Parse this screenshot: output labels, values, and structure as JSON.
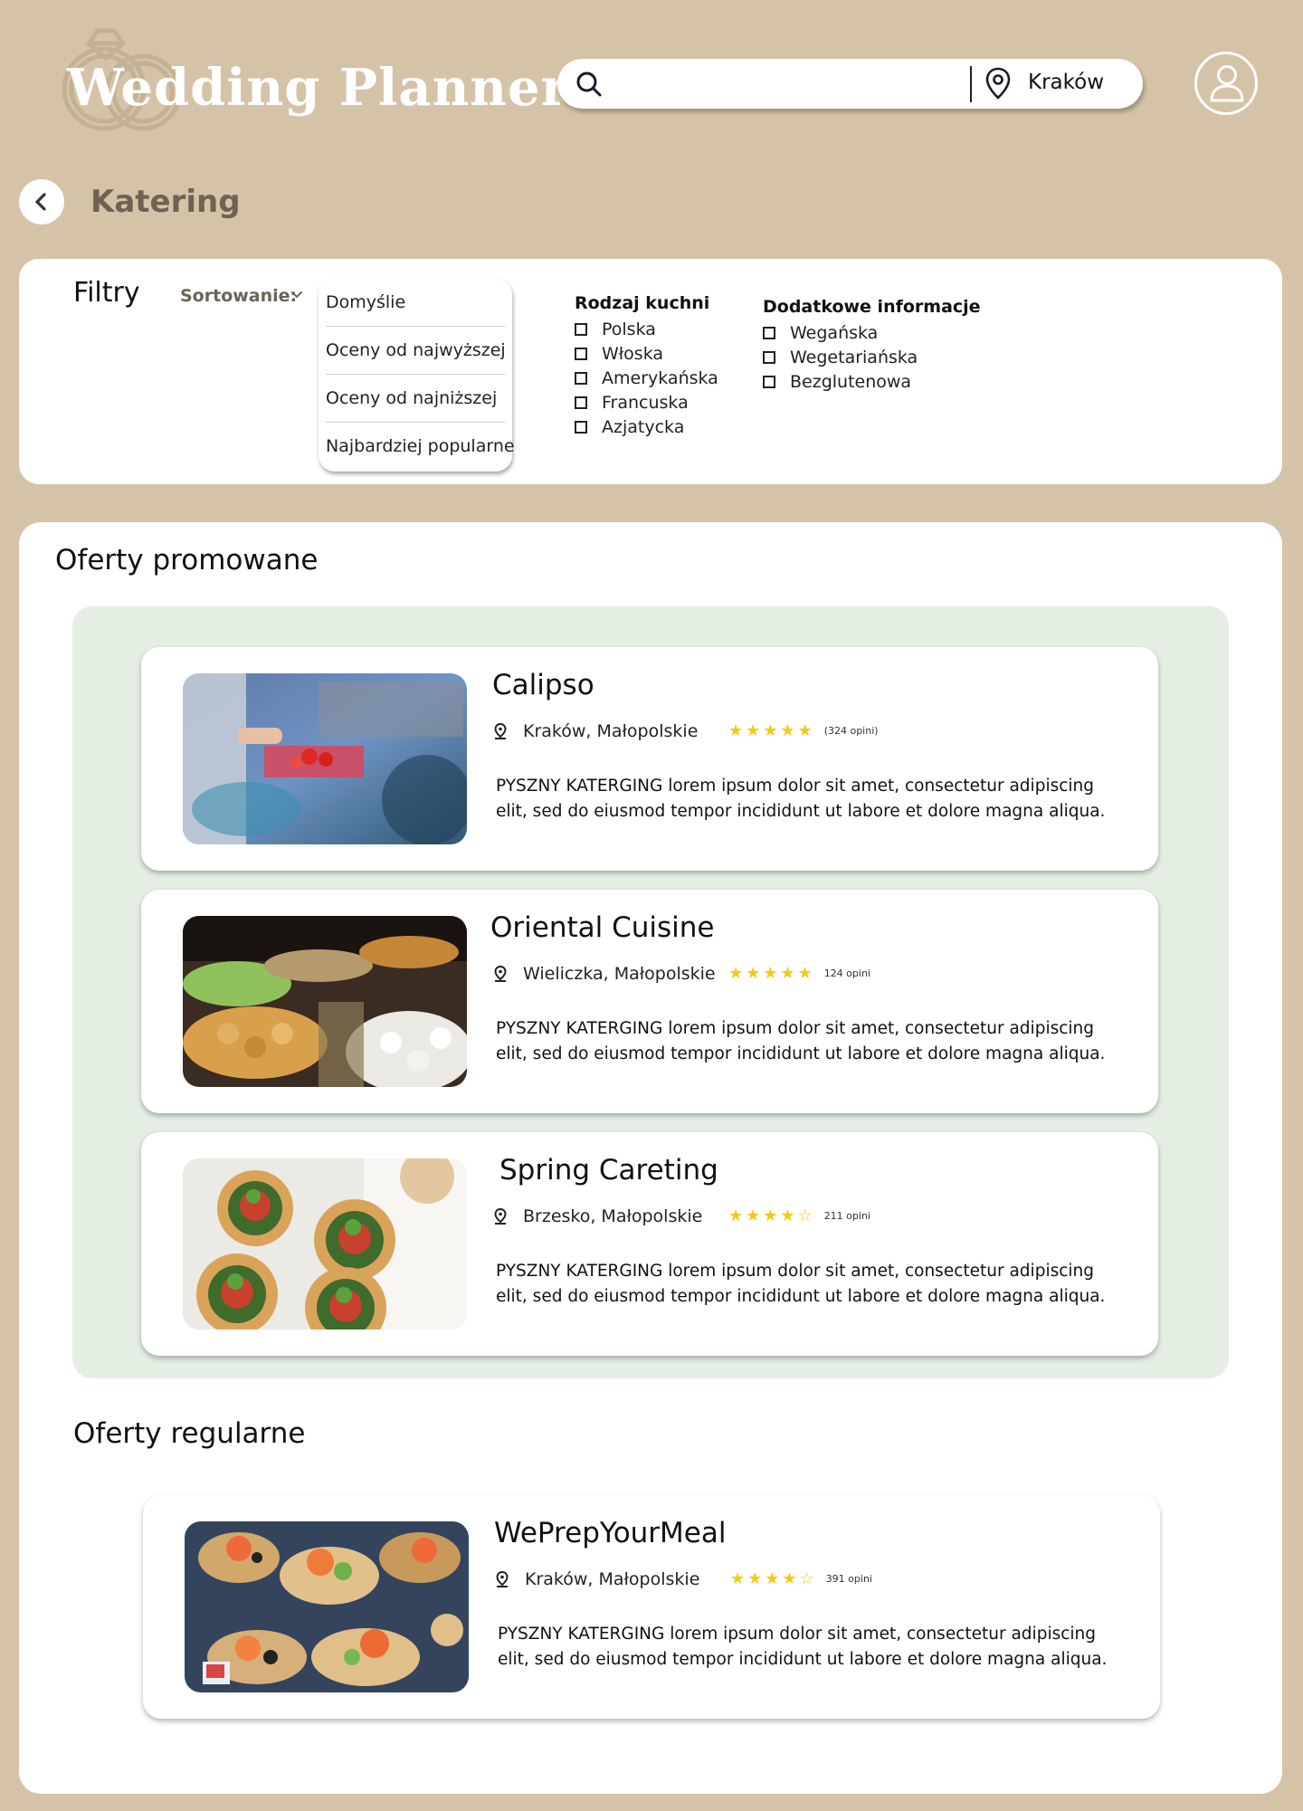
{
  "header": {
    "logo_text": "Wedding Planner",
    "search_placeholder": "",
    "location": "Kraków"
  },
  "page": {
    "title": "Katering"
  },
  "filters": {
    "title": "Filtry",
    "sort_label": "Sortowanie:",
    "sort_options": [
      "Domyślie",
      "Oceny od najwyższej",
      "Oceny od najniższej",
      "Najbardziej popularne"
    ],
    "cuisine": {
      "title": "Rodzaj kuchni",
      "options": [
        "Polska",
        "Włoska",
        "Amerykańska",
        "Francuska",
        "Azjatycka"
      ]
    },
    "extra": {
      "title": "Dodatkowe informacje",
      "options": [
        "Wegańska",
        "Wegetariańska",
        "Bezglutenowa"
      ]
    }
  },
  "promoted": {
    "title": "Oferty promowane",
    "offers": [
      {
        "name": "Calipso",
        "location": "Kraków, Małopolskie",
        "stars": "★★★★★",
        "rating": 5,
        "reviews": "(324 opini)",
        "description": "PYSZNY KATERGING lorem ipsum dolor sit amet, consectetur adipiscing elit, sed do eiusmod tempor incididunt ut labore et dolore magna aliqua."
      },
      {
        "name": "Oriental Cuisine",
        "location": "Wieliczka, Małopolskie",
        "stars": "★★★★★",
        "rating": 5,
        "reviews": "124 opini",
        "description": "PYSZNY KATERGING lorem ipsum dolor sit amet, consectetur adipiscing elit, sed do eiusmod tempor incididunt ut labore et dolore magna aliqua."
      },
      {
        "name": "Spring Careting",
        "location": "Brzesko, Małopolskie",
        "stars": "★★★★☆",
        "rating": 4.5,
        "reviews": "211 opini",
        "description": "PYSZNY KATERGING lorem ipsum dolor sit amet, consectetur adipiscing elit, sed do eiusmod tempor incididunt ut labore et dolore magna aliqua."
      }
    ]
  },
  "regular": {
    "title": "Oferty regularne",
    "offers": [
      {
        "name": "WePrepYourMeal",
        "location": "Kraków, Małopolskie",
        "stars": "★★★★☆",
        "rating": 4.5,
        "reviews": "391 opini",
        "description": "PYSZNY KATERGING lorem ipsum dolor sit amet, consectetur adipiscing elit, sed do eiusmod tempor incididunt ut labore et dolore magna aliqua."
      }
    ]
  },
  "colors": {
    "background": "#d5c3a7",
    "panel": "#ffffff",
    "promo_background": "#e4eee3",
    "star": "#f6c915",
    "title_brown": "#6e6255"
  }
}
